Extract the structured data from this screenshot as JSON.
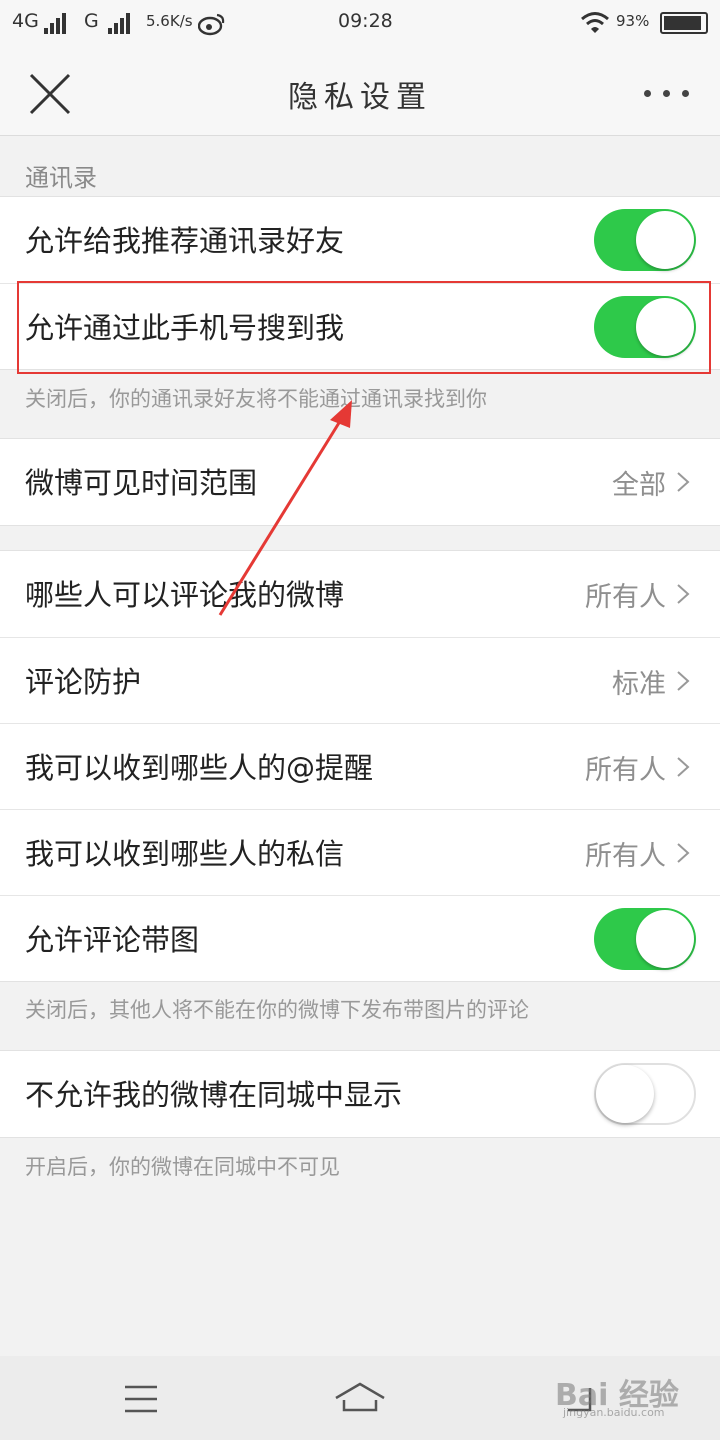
{
  "status_bar": {
    "network1": "4G",
    "network2": "G",
    "speed": "5.6K/s",
    "time": "09:28",
    "battery": "93%",
    "battery_level": 0.93
  },
  "header": {
    "title": "隐私设置"
  },
  "contacts": {
    "section_title": "通讯录",
    "recommend_label": "允许给我推荐通讯录好友",
    "recommend_on": true,
    "phone_search_label": "允许通过此手机号搜到我",
    "phone_search_on": true,
    "hint": "关闭后，你的通讯录好友将不能通过通讯录找到你"
  },
  "weibo_visibility": {
    "label": "微博可见时间范围",
    "value": "全部"
  },
  "interactions": {
    "items": [
      {
        "label": "哪些人可以评论我的微博",
        "value": "所有人"
      },
      {
        "label": "评论防护",
        "value": "标准"
      },
      {
        "label": "我可以收到哪些人的@提醒",
        "value": "所有人"
      },
      {
        "label": "我可以收到哪些人的私信",
        "value": "所有人"
      }
    ],
    "comment_image_label": "允许评论带图",
    "comment_image_on": true,
    "comment_image_hint": "关闭后，其他人将不能在你的微博下发布带图片的评论"
  },
  "same_city": {
    "label": "不允许我的微博在同城中显示",
    "on": false,
    "hint": "开启后，你的微博在同城中不可见"
  },
  "watermark": {
    "text": "Bai 经验",
    "url": "jingyan.baidu.com"
  },
  "colors": {
    "toggle_on": "#2ec94a",
    "annotation": "#e53935"
  }
}
